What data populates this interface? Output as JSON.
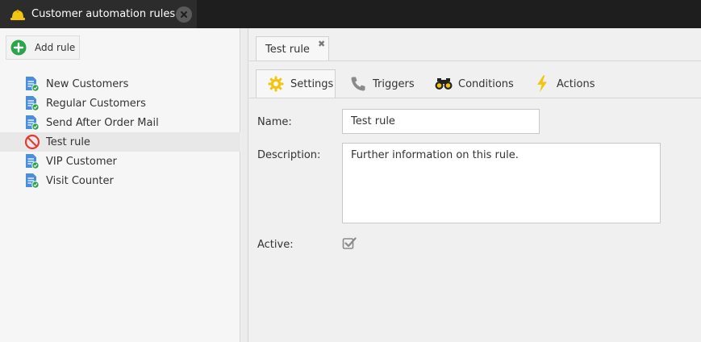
{
  "app": {
    "title": "Customer automation rules"
  },
  "sidebar": {
    "add_label": "Add rule",
    "items": [
      {
        "label": "New Customers",
        "icon": "rule-document-icon",
        "selected": false
      },
      {
        "label": "Regular Customers",
        "icon": "rule-document-icon",
        "selected": false
      },
      {
        "label": "Send After Order Mail",
        "icon": "rule-document-icon",
        "selected": false
      },
      {
        "label": "Test rule",
        "icon": "disabled-rule-icon",
        "selected": true
      },
      {
        "label": "VIP Customer",
        "icon": "rule-document-icon",
        "selected": false
      },
      {
        "label": "Visit Counter",
        "icon": "rule-document-icon",
        "selected": false
      }
    ]
  },
  "document_tab": {
    "label": "Test rule",
    "close_glyph": "✖"
  },
  "tabs": [
    {
      "label": "Settings",
      "icon": "gear-icon",
      "active": true
    },
    {
      "label": "Triggers",
      "icon": "phone-icon",
      "active": false
    },
    {
      "label": "Conditions",
      "icon": "binoculars-icon",
      "active": false
    },
    {
      "label": "Actions",
      "icon": "lightning-icon",
      "active": false
    }
  ],
  "form": {
    "name_label": "Name:",
    "name_value": "Test rule",
    "description_label": "Description:",
    "description_value": "Further information on this rule.",
    "active_label": "Active:",
    "active_checked": true
  },
  "colors": {
    "topbar": "#1e1e1e",
    "accent_green": "#2aa54a",
    "doc_blue": "#4a8fdc",
    "disabled_red": "#e53935",
    "icon_yellow": "#f2c511"
  }
}
